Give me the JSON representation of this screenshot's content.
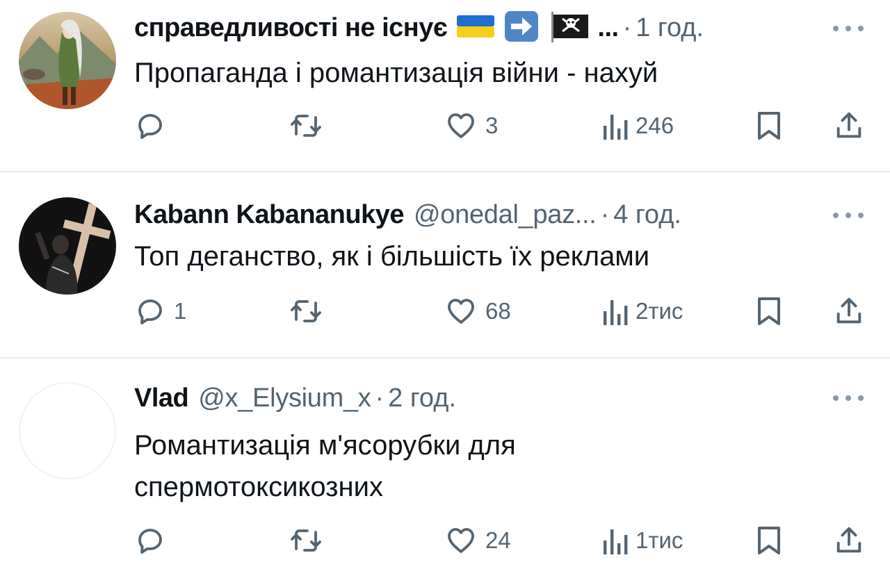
{
  "tweets": [
    {
      "display_name": "справедливості не існує",
      "name_suffix": "...",
      "handle": "",
      "separator": "·",
      "time": "1 год.",
      "text_lines": [
        "Пропаганда і романтизація війни -  нахуй"
      ],
      "reply_count": "",
      "repost_count": "",
      "like_count": "3",
      "view_count": "246",
      "flags": [
        "ukraine-flag-icon",
        "arrow-right-emoji-icon",
        "pirate-flag-icon"
      ]
    },
    {
      "display_name": "Kabann Kabananukye",
      "name_suffix": "",
      "handle": "@onedal_paz...",
      "separator": "·",
      "time": "4 год.",
      "text_lines": [
        "Топ дeганство, як і більшість їх реклами"
      ],
      "reply_count": "1",
      "repost_count": "",
      "like_count": "68",
      "view_count": "2тис"
    },
    {
      "display_name": "Vlad",
      "name_suffix": "",
      "handle": "@x_Elysium_x",
      "separator": "·",
      "time": "2 год.",
      "text_lines": [
        "Романтизація м'ясорубки для",
        "спермотоксикозних"
      ],
      "reply_count": "",
      "repost_count": "",
      "like_count": "24",
      "view_count": "1тис"
    }
  ],
  "colors": {
    "text": "#0f1419",
    "secondary": "#536471",
    "divider": "#e7e9ea",
    "icon": "#536471"
  }
}
